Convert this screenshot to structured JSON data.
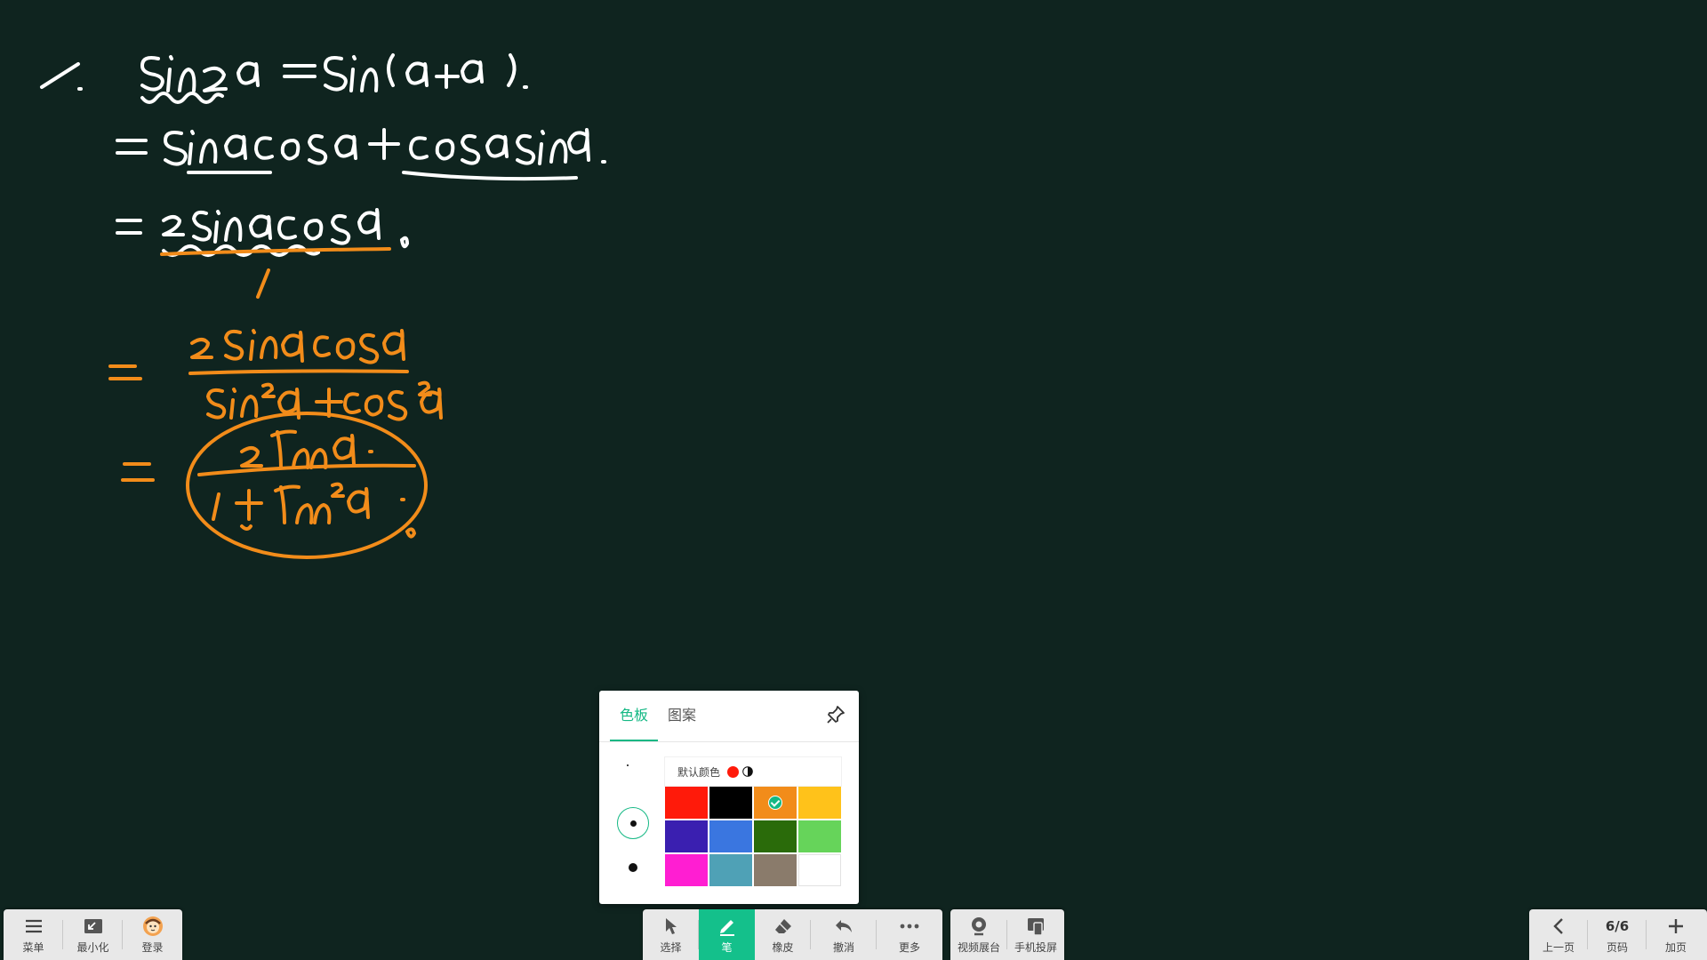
{
  "board": {
    "strokes_white": [
      "1.",
      "sin2α = sin(α+α).",
      "= sinαcosα + cosαsinα.",
      "= 2sinαcosα."
    ],
    "strokes_orange": [
      "2sinαcosα",
      "sin²α+cos²α",
      "= 2tanα / 1+tan²α"
    ]
  },
  "toolbar_left": [
    {
      "label": "菜单",
      "icon": "menu-icon"
    },
    {
      "label": "最小化",
      "icon": "minimize-icon"
    },
    {
      "label": "登录",
      "icon": "avatar-icon"
    }
  ],
  "toolbar_tools": [
    {
      "label": "选择",
      "icon": "cursor-icon"
    },
    {
      "label": "笔",
      "icon": "pen-icon",
      "active": true
    },
    {
      "label": "橡皮",
      "icon": "eraser-icon"
    },
    {
      "label": "撤消",
      "icon": "undo-icon"
    },
    {
      "label": "更多",
      "icon": "more-icon"
    }
  ],
  "toolbar_media": [
    {
      "label": "视频展台",
      "icon": "camera-icon"
    },
    {
      "label": "手机投屏",
      "icon": "phone-cast-icon"
    }
  ],
  "toolbar_page": {
    "prev_label": "上一页",
    "page_value": "6/6",
    "page_label": "页码",
    "add_label": "加页"
  },
  "palette": {
    "tabs": [
      "色板",
      "图案"
    ],
    "active_tab": 0,
    "default_color_label": "默认颜色",
    "pen_sizes": [
      "small",
      "medium",
      "large"
    ],
    "selected_size": 1,
    "colors": [
      "#ff1a0a",
      "#000000",
      "#f28c1a",
      "#ffc21a",
      "#3a1fb0",
      "#3a76e0",
      "#2a6b0a",
      "#66d45a",
      "#ff1ed2",
      "#4fa1b6",
      "#8a7b6b",
      "#ffffff"
    ],
    "selected_color": 2
  }
}
